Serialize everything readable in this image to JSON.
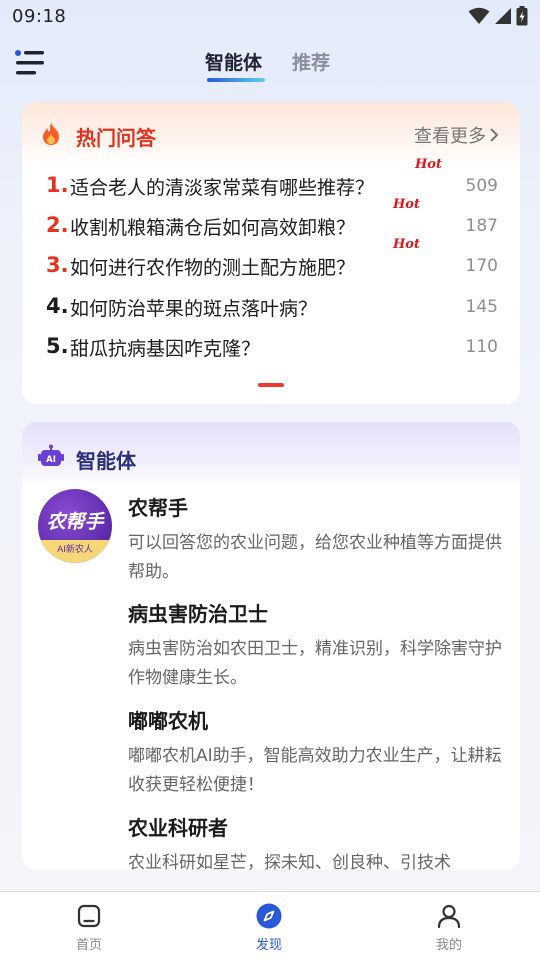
{
  "status_bar": {
    "time": "09:18"
  },
  "top_nav": {
    "tabs": [
      {
        "label": "智能体",
        "active": true
      },
      {
        "label": "推荐",
        "active": false
      }
    ]
  },
  "hot_qa": {
    "title": "热门问答",
    "more_label": "查看更多",
    "items": [
      {
        "rank": "1.",
        "question": "适合老人的清淡家常菜有哪些推荐？",
        "count": "509",
        "tag": "Hot",
        "rank_color": "#e8321f"
      },
      {
        "rank": "2.",
        "question": "收割机粮箱满仓后如何高效卸粮？",
        "count": "187",
        "tag": "Hot",
        "rank_color": "#e8321f"
      },
      {
        "rank": "3.",
        "question": "如何进行农作物的测土配方施肥？",
        "count": "170",
        "tag": "Hot",
        "rank_color": "#e8321f"
      },
      {
        "rank": "4.",
        "question": "如何防治苹果的斑点落叶病？",
        "count": "145",
        "tag": "",
        "rank_color": "#1d1d1d"
      },
      {
        "rank": "5.",
        "question": "甜瓜抗病基因咋克隆？",
        "count": "110",
        "tag": "",
        "rank_color": "#1d1d1d"
      }
    ]
  },
  "agents": {
    "title": "智能体",
    "avatar": {
      "text": "农帮手",
      "sub": "AI新农人"
    },
    "items": [
      {
        "name": "农帮手",
        "desc": "可以回答您的农业问题，给您农业种植等方面提供帮助。"
      },
      {
        "name": "病虫害防治卫士",
        "desc": "病虫害防治如农田卫士，精准识别，科学除害守护作物健康生长。"
      },
      {
        "name": "嘟嘟农机",
        "desc": "嘟嘟农机AI助手，智能高效助力农业生产，让耕耘收获更轻松便捷！"
      },
      {
        "name": "农业科研者",
        "desc": "农业科研如星芒，探未知、创良种、引技术"
      }
    ]
  },
  "bottom_nav": {
    "items": [
      {
        "label": "首页",
        "icon": "home-icon",
        "active": false
      },
      {
        "label": "发现",
        "icon": "discover-compass-icon",
        "active": true
      },
      {
        "label": "我的",
        "icon": "profile-icon",
        "active": false
      }
    ]
  },
  "colors": {
    "accent": "#2a58d6",
    "hot": "#e1321e",
    "agent_title": "#2b2f7a"
  }
}
